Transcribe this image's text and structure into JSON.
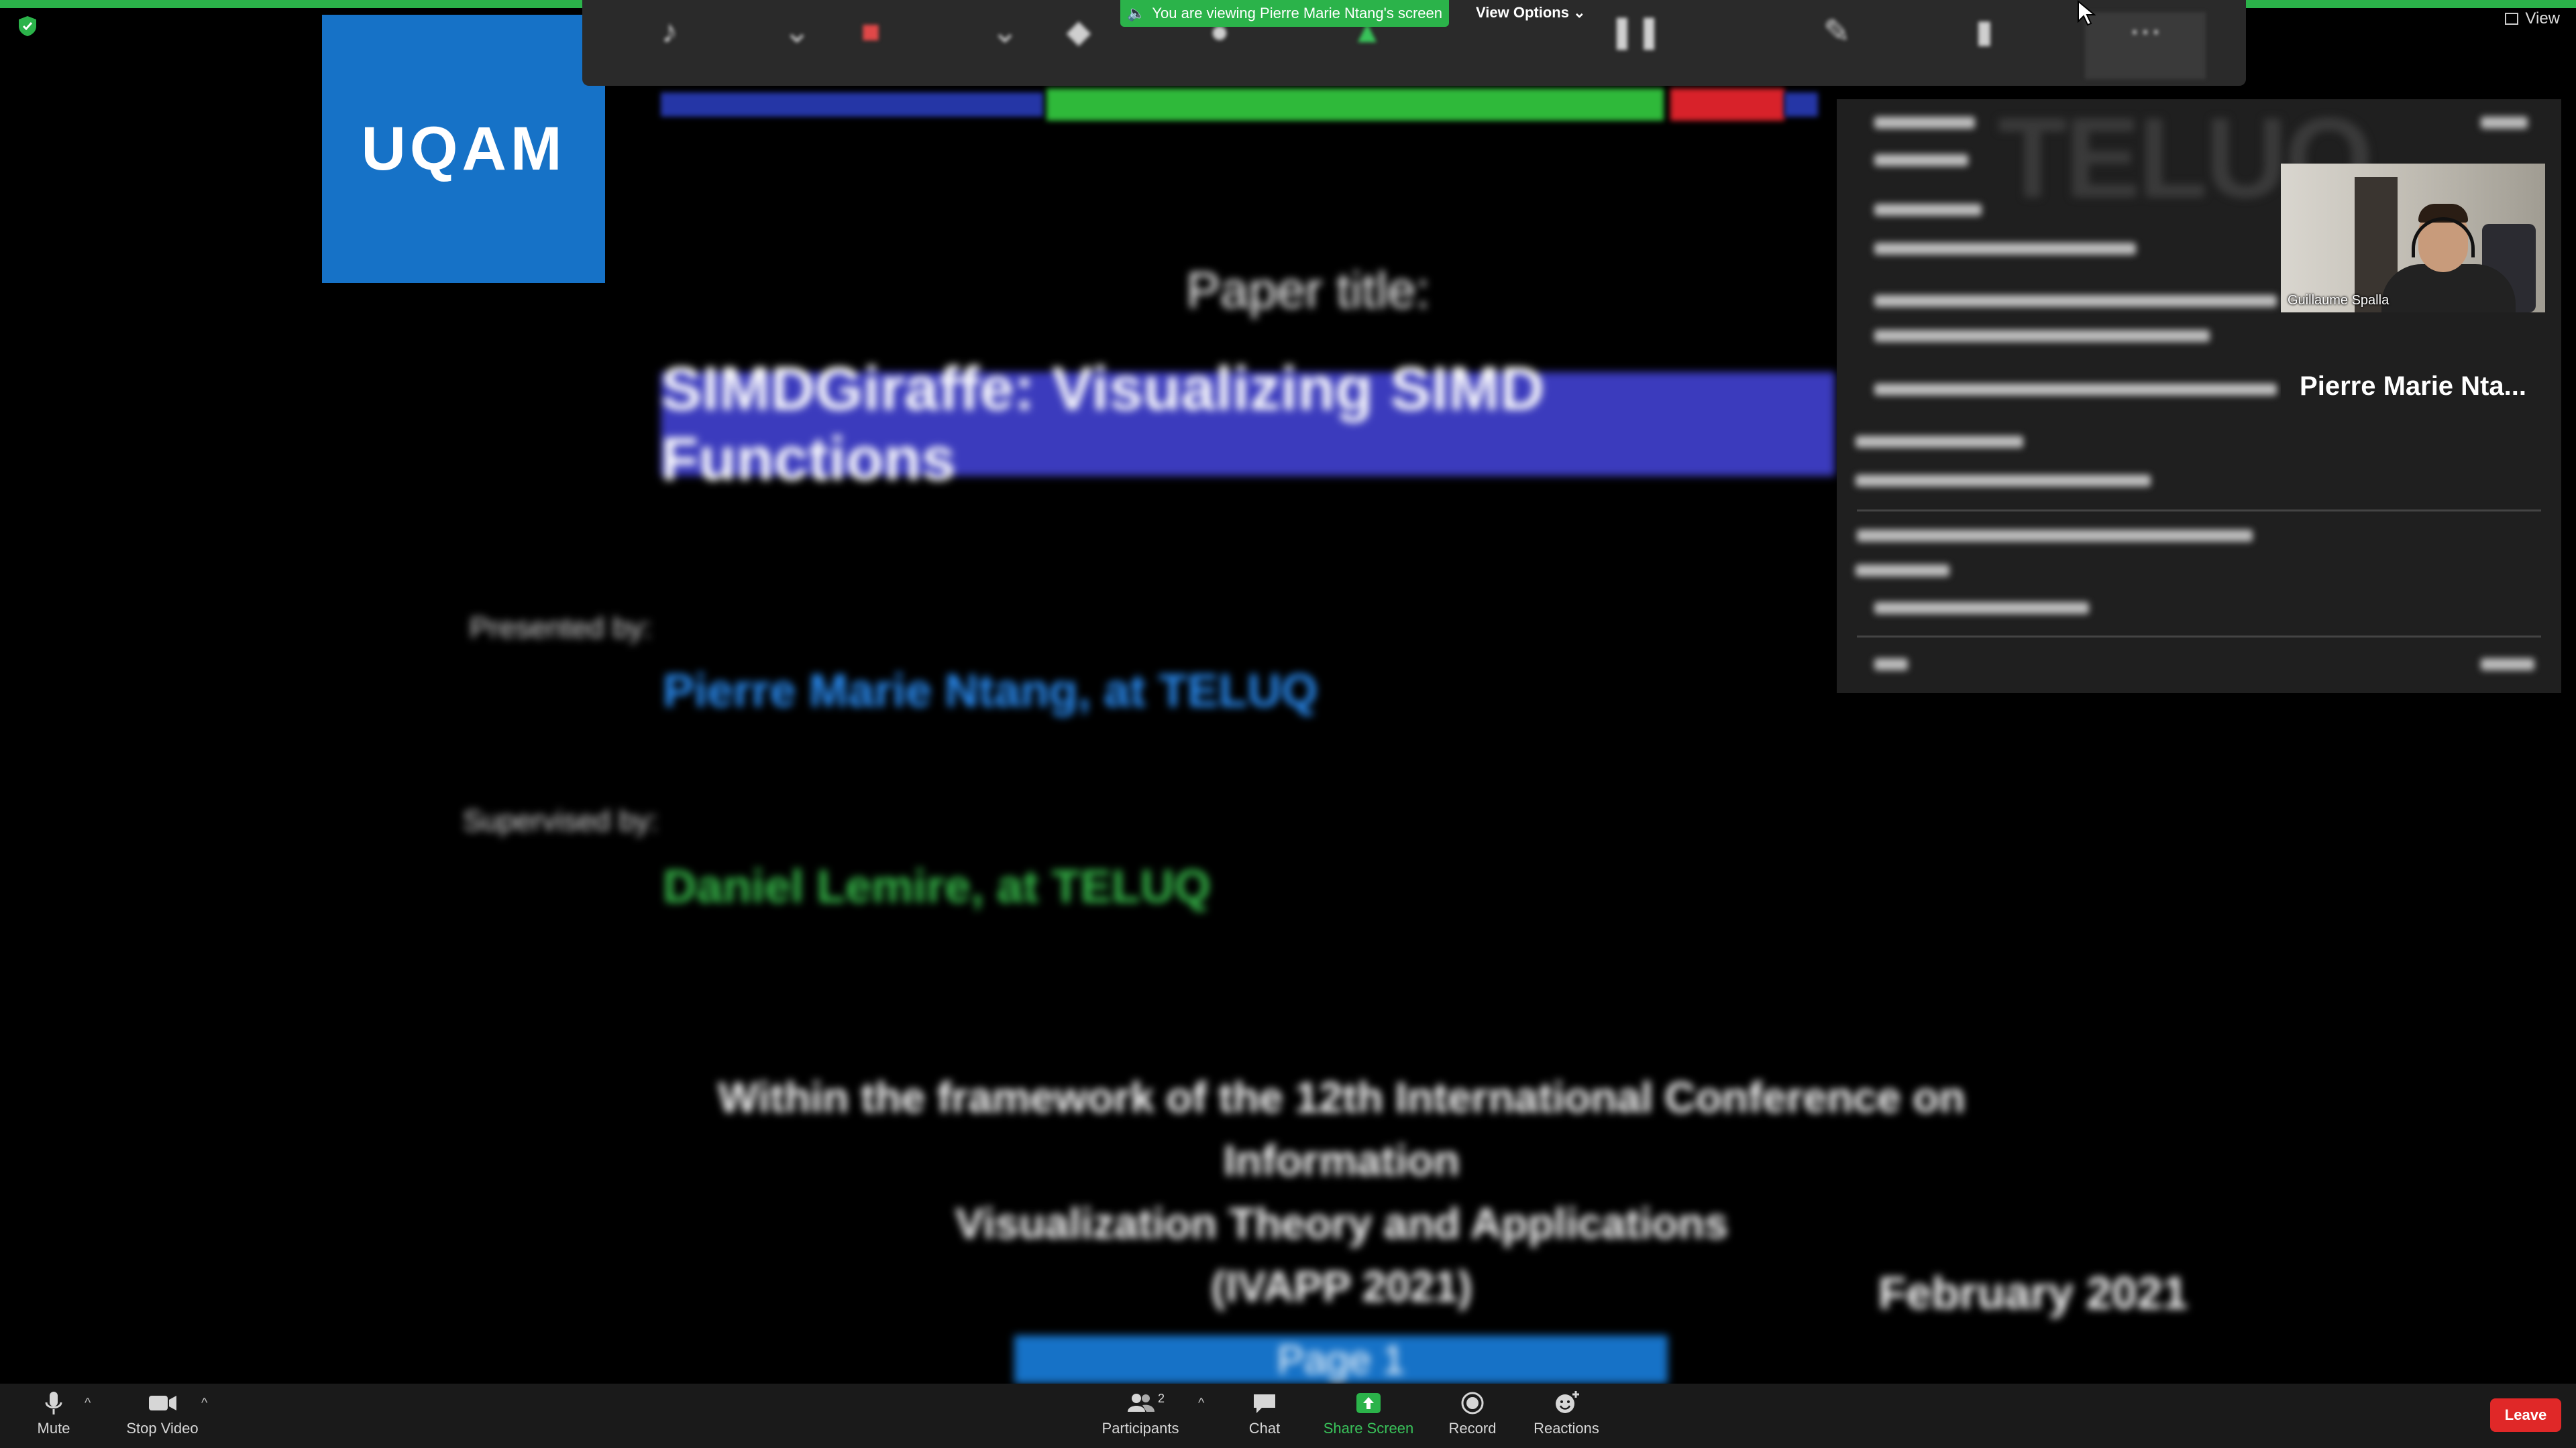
{
  "window": {
    "view_label": "View"
  },
  "share_banner": {
    "viewing_text": "You are viewing Pierre Marie Ntang's screen",
    "view_options_label": "View Options"
  },
  "slide": {
    "logo_text": "UQAM",
    "paper_label": "Paper title:",
    "title": "SIMDGiraffe: Visualizing SIMD Functions",
    "presented_by_label": "Presented by:",
    "presenter": "Pierre Marie Ntang, at TELUQ",
    "supervised_by_label": "Supervised by:",
    "supervisor": "Daniel Lemire, at TELUQ",
    "conference_line1": "Within the framework of the 12th International Conference on Information",
    "conference_line2": "Visualization Theory and Applications",
    "conference_line3": "(IVAPP 2021)",
    "date": "February 2021",
    "next_button": "Page 1"
  },
  "notes_panel": {
    "watermark": "TELUQ"
  },
  "participants": {
    "video_name": "Guillaume Spalla",
    "name_tile": "Pierre Marie Nta..."
  },
  "meeting_controls": {
    "mute": "Mute",
    "stop_video": "Stop Video",
    "participants": "Participants",
    "participants_count": "2",
    "chat": "Chat",
    "share_screen": "Share Screen",
    "record": "Record",
    "reactions": "Reactions",
    "leave": "Leave"
  },
  "colors": {
    "accent_green": "#2bb34a",
    "leave_red": "#e02828",
    "title_blue": "#3b3bbd",
    "logo_blue": "#1672c7"
  }
}
